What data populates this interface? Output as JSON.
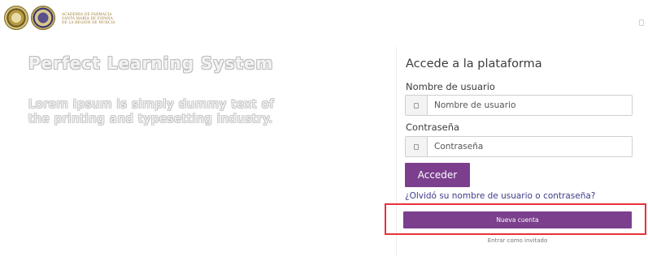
{
  "header": {
    "logo_text": [
      "ACADEMIA DE FARMACIA",
      "SANTA MARÍA DE ESPAÑA",
      "DE LA REGIÓN DE MURCIA"
    ]
  },
  "hero": {
    "title": "Perfect Learning System",
    "text": "Lorem Ipsum is simply dummy text of the printing and typesetting industry."
  },
  "login": {
    "title": "Accede a la plataforma",
    "username_label": "Nombre de usuario",
    "username_placeholder": "Nombre de usuario",
    "password_label": "Contraseña",
    "password_placeholder": "Contraseña",
    "submit_label": "Acceder",
    "forgot_link": "¿Olvidó su nombre de usuario o contraseña?",
    "new_account_label": "Nueva cuenta",
    "guest_link": "Entrar como invitado"
  },
  "colors": {
    "accent": "#7b3f8d",
    "highlight": "#e8313a",
    "link": "#3b3b8b"
  },
  "icons": {
    "field_addon": "user-icon",
    "password_addon": "lock-icon",
    "header_right": "menu-icon"
  }
}
